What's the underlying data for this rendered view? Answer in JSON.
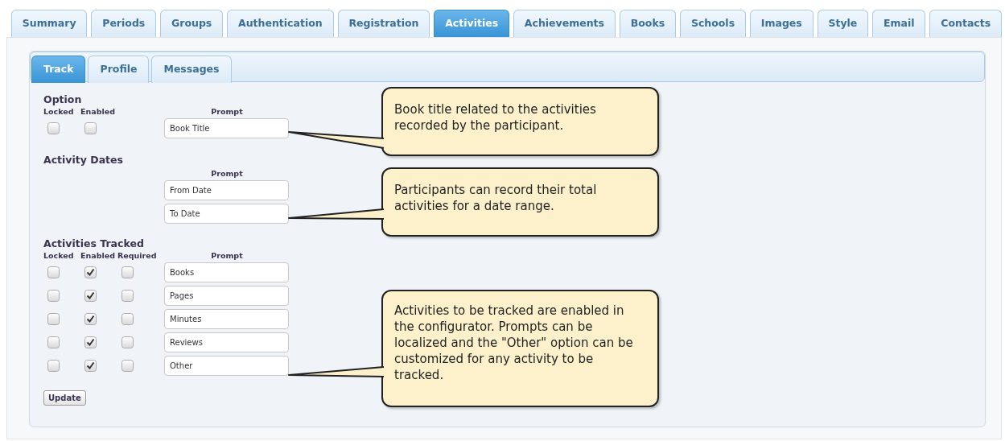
{
  "tabs": [
    {
      "label": "Summary",
      "selected": false
    },
    {
      "label": "Periods",
      "selected": false
    },
    {
      "label": "Groups",
      "selected": false
    },
    {
      "label": "Authentication",
      "selected": false
    },
    {
      "label": "Registration",
      "selected": false
    },
    {
      "label": "Activities",
      "selected": true
    },
    {
      "label": "Achievements",
      "selected": false
    },
    {
      "label": "Books",
      "selected": false
    },
    {
      "label": "Schools",
      "selected": false
    },
    {
      "label": "Images",
      "selected": false
    },
    {
      "label": "Style",
      "selected": false
    },
    {
      "label": "Email",
      "selected": false
    },
    {
      "label": "Contacts",
      "selected": false
    }
  ],
  "subtabs": [
    {
      "label": "Track",
      "selected": true
    },
    {
      "label": "Profile",
      "selected": false
    },
    {
      "label": "Messages",
      "selected": false
    }
  ],
  "option": {
    "title": "Option",
    "headers": [
      "Locked",
      "Enabled"
    ],
    "prompt_header": "Prompt",
    "rows": [
      {
        "locked": false,
        "enabled": false,
        "prompt": "Book Title"
      }
    ]
  },
  "activity_dates": {
    "title": "Activity Dates",
    "prompt_header": "Prompt",
    "fields": [
      "From Date",
      "To Date"
    ]
  },
  "activities_tracked": {
    "title": "Activities Tracked",
    "headers": [
      "Locked",
      "Enabled",
      "Required"
    ],
    "prompt_header": "Prompt",
    "rows": [
      {
        "locked": false,
        "enabled": true,
        "required": false,
        "prompt": "Books"
      },
      {
        "locked": false,
        "enabled": true,
        "required": false,
        "prompt": "Pages"
      },
      {
        "locked": false,
        "enabled": true,
        "required": false,
        "prompt": "Minutes"
      },
      {
        "locked": false,
        "enabled": true,
        "required": false,
        "prompt": "Reviews"
      },
      {
        "locked": false,
        "enabled": true,
        "required": false,
        "prompt": "Other"
      }
    ]
  },
  "update_button": "Update",
  "callouts": [
    {
      "text": "Book title related to the activities recorded by the participant."
    },
    {
      "text": "Participants can record their total activities for a date range."
    },
    {
      "text": "Activities to be tracked are enabled in the configurator. Prompts can be localized and the \"Other\" option can be customized for any activity to be tracked."
    }
  ]
}
